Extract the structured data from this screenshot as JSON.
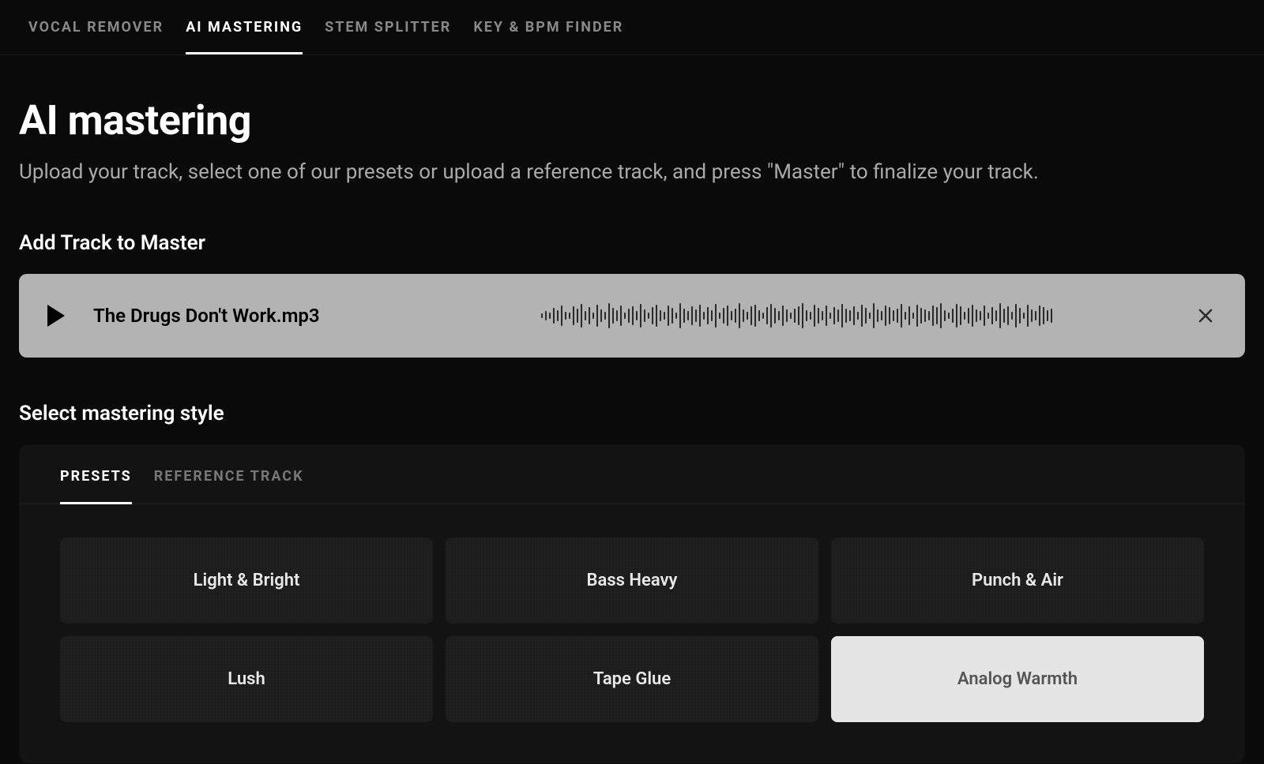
{
  "nav": {
    "items": [
      {
        "label": "Vocal Remover",
        "active": false
      },
      {
        "label": "AI Mastering",
        "active": true
      },
      {
        "label": "Stem Splitter",
        "active": false
      },
      {
        "label": "Key & BPM Finder",
        "active": false
      }
    ]
  },
  "page": {
    "title": "AI mastering",
    "subtitle": "Upload your track, select one of our presets or upload a reference track, and press \"Master\" to finalize your track."
  },
  "track_section": {
    "title": "Add Track to Master",
    "filename": "The Drugs Don't Work.mp3"
  },
  "style_section": {
    "title": "Select mastering style",
    "tabs": [
      {
        "label": "Presets",
        "active": true
      },
      {
        "label": "Reference Track",
        "active": false
      }
    ],
    "presets": [
      {
        "label": "Light & Bright",
        "selected": false
      },
      {
        "label": "Bass Heavy",
        "selected": false
      },
      {
        "label": "Punch & Air",
        "selected": false
      },
      {
        "label": "Lush",
        "selected": false
      },
      {
        "label": "Tape Glue",
        "selected": false
      },
      {
        "label": "Analog Warmth",
        "selected": true
      }
    ]
  }
}
